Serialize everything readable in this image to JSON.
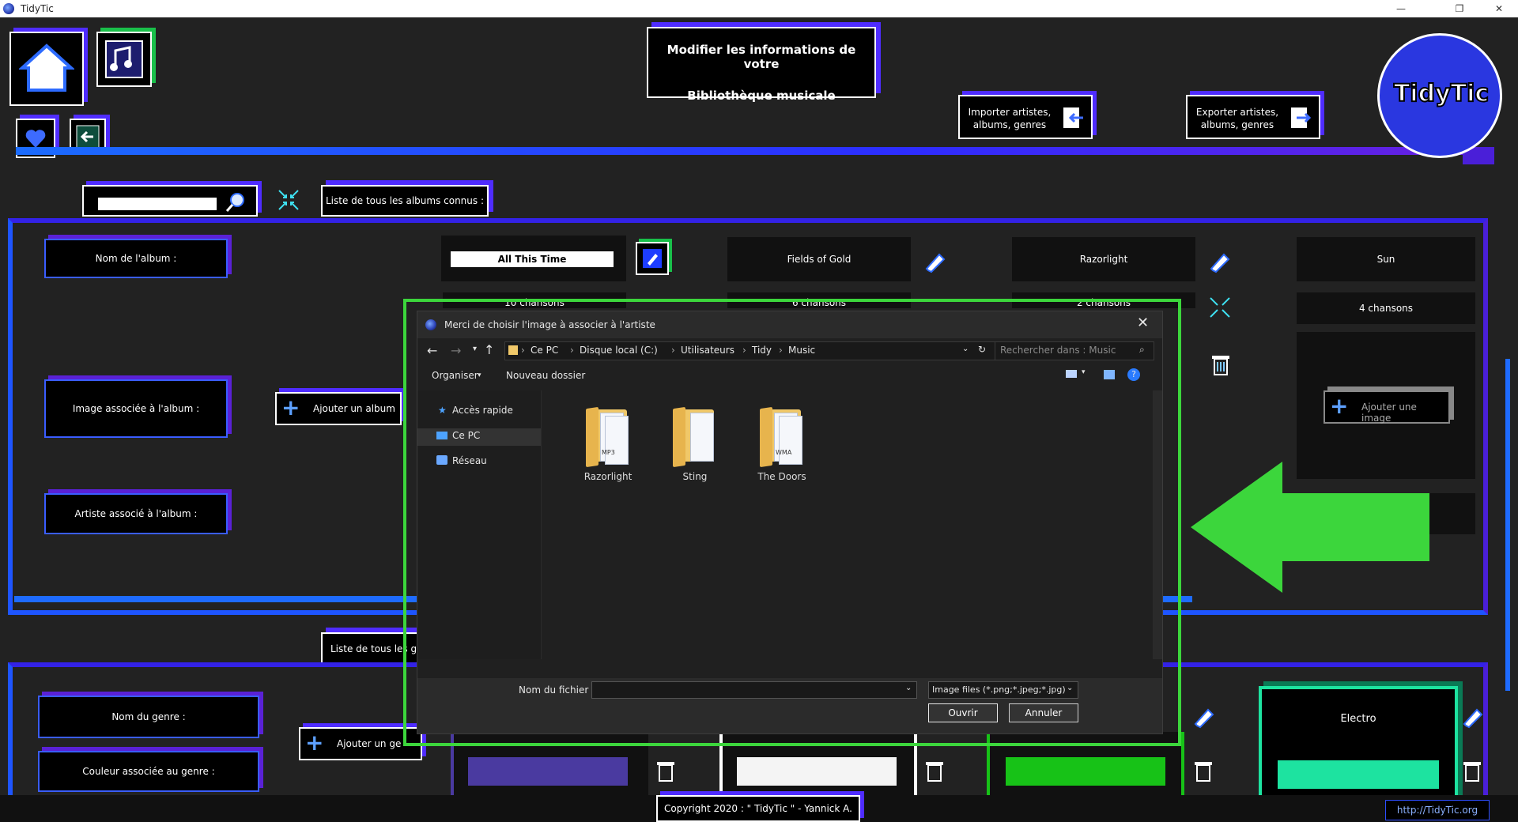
{
  "window": {
    "title": "TidyTic",
    "controls": [
      "—",
      "❐",
      "✕"
    ]
  },
  "header": {
    "title_line1": "Modifier les informations de votre",
    "title_line2": "Bibliothèque musicale",
    "import_label": "Importer artistes, albums, genres",
    "export_label": "Exporter artistes, albums, genres",
    "logo_text": "TidyTic"
  },
  "albums": {
    "tab_label": "Liste de tous les albums connus :",
    "search_placeholder": "",
    "label_name": "Nom de l'album :",
    "label_image": "Image associée à l'album :",
    "label_artist": "Artiste associé à l'album :",
    "add_album": "Ajouter un album",
    "cards": [
      {
        "name": "All This Time",
        "songs": "10 chansons"
      },
      {
        "name": "Fields of Gold",
        "songs": "6 chansons"
      },
      {
        "name": "Razorlight",
        "songs": "2 chansons"
      },
      {
        "name": "Sun",
        "songs": "4 chansons"
      }
    ],
    "add_image": "Ajouter une image"
  },
  "genres": {
    "tab_label": "Liste de tous les ge",
    "label_name": "Nom du genre :",
    "label_color": "Couleur associée au genre :",
    "add_genre": "Ajouter un ge",
    "last_genre": "Electro",
    "colors": [
      "#4a3aa0",
      "#f4f4f4",
      "#17c217",
      "#1de3a0"
    ]
  },
  "footer": {
    "copyright": "Copyright 2020 : \" TidyTic \" - Yannick A.",
    "link": "http://TidyTic.org"
  },
  "dialog": {
    "title": "Merci de choisir l'image à associer à l'artiste",
    "breadcrumb": [
      "Ce PC",
      "Disque local (C:)",
      "Utilisateurs",
      "Tidy",
      "Music"
    ],
    "search_placeholder": "Rechercher dans : Music",
    "organiser": "Organiser",
    "new_folder": "Nouveau dossier",
    "nav": [
      "Accès rapide",
      "Ce PC",
      "Réseau"
    ],
    "folders": [
      {
        "name": "Razorlight",
        "badge": "MP3"
      },
      {
        "name": "Sting",
        "badge": ""
      },
      {
        "name": "The Doors",
        "badge": "WMA"
      }
    ],
    "filename_label": "Nom du fichier :",
    "filetype": "Image files (*.png;*.jpeg;*.jpg)",
    "open": "Ouvrir",
    "cancel": "Annuler"
  },
  "colors": {
    "accent_blue": "#1e55ff",
    "accent_purple": "#5a21d6",
    "highlight_green": "#3cd63c"
  }
}
